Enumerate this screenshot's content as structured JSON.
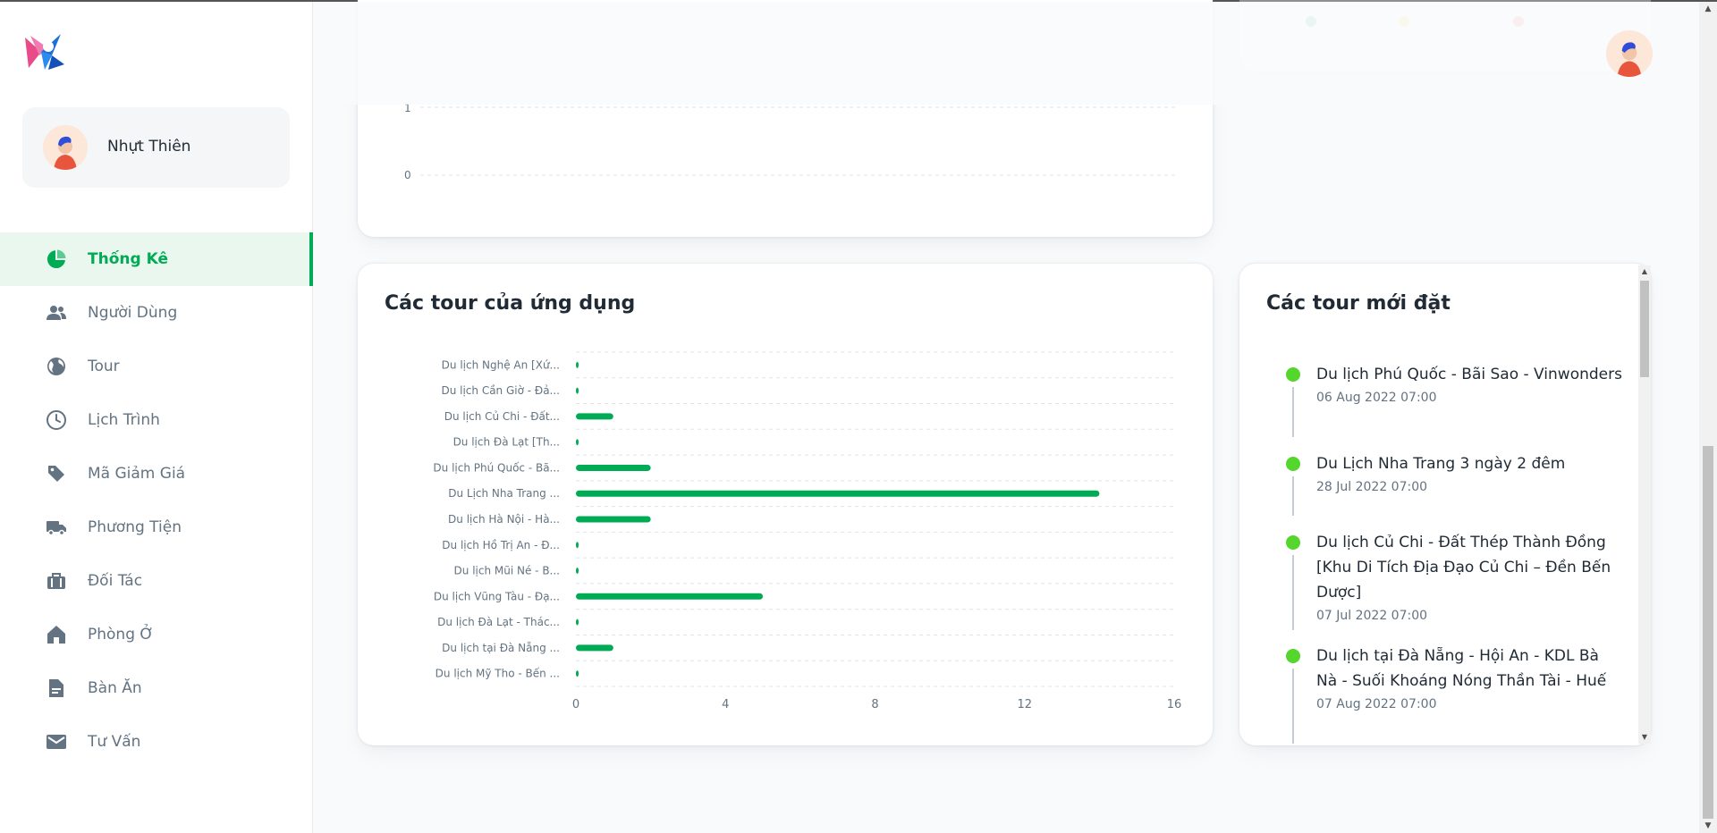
{
  "user": {
    "name": "Nhựt Thiên"
  },
  "nav": [
    {
      "label": "Thống Kê",
      "icon": "pie-chart-icon",
      "active": true
    },
    {
      "label": "Người Dùng",
      "icon": "people-icon"
    },
    {
      "label": "Tour",
      "icon": "globe-icon"
    },
    {
      "label": "Lịch Trình",
      "icon": "clock-icon"
    },
    {
      "label": "Mã Giảm Giá",
      "icon": "tag-icon"
    },
    {
      "label": "Phương Tiện",
      "icon": "truck-icon"
    },
    {
      "label": "Đối Tác",
      "icon": "briefcase-icon"
    },
    {
      "label": "Phòng Ở",
      "icon": "home-icon"
    },
    {
      "label": "Bàn Ăn",
      "icon": "document-icon"
    },
    {
      "label": "Tư Vấn",
      "icon": "mail-icon"
    }
  ],
  "top_chart": {
    "tick_labels": [
      "1",
      "0"
    ]
  },
  "tours_card": {
    "title": "Các tour của ứng dụng"
  },
  "chart_data": {
    "type": "bar",
    "orientation": "horizontal",
    "color": "#00ab55",
    "categories": [
      "Du lịch Nghệ An [Xứ...",
      "Du lịch Cần Giờ - Đả...",
      "Du lịch Củ Chi - Đất...",
      "Du lịch Đà Lạt [Th...",
      "Du lịch Phú Quốc - Bã...",
      "Du Lịch Nha Trang ...",
      "Du lịch Hà Nội - Hà...",
      "Du lịch Hồ Trị An - Đ...",
      "Du lịch Mũi Né - B...",
      "Du lịch Vũng Tàu - Đạ...",
      "Du lịch Đà Lạt - Thác...",
      "Du lịch tại Đà Nẵng ...",
      "Du lịch Mỹ Tho - Bến ..."
    ],
    "values": [
      0,
      0,
      1,
      0,
      2,
      14,
      2,
      0,
      0,
      5,
      0,
      1,
      0
    ],
    "xlim": [
      0,
      16
    ],
    "xticks": [
      "0",
      "4",
      "8",
      "12",
      "16"
    ],
    "grid": true
  },
  "recent_card": {
    "title": "Các tour mới đặt",
    "items": [
      {
        "title": "Du lịch Phú Quốc - Bãi Sao - Vinwonders",
        "time": "06 Aug 2022 07:00"
      },
      {
        "title": "Du Lịch Nha Trang 3 ngày 2 đêm",
        "time": "28 Jul 2022 07:00"
      },
      {
        "title": "Du lịch Củ Chi - Đất Thép Thành Đồng [Khu Di Tích Địa Đạo Củ Chi – Đền Bến Dược]",
        "time": "07 Jul 2022 07:00"
      },
      {
        "title": "Du lịch tại Đà Nẵng - Hội An - KDL Bà Nà - Suối Khoáng Nóng Thần Tài - Huế",
        "time": "07 Aug 2022 07:00"
      }
    ]
  }
}
